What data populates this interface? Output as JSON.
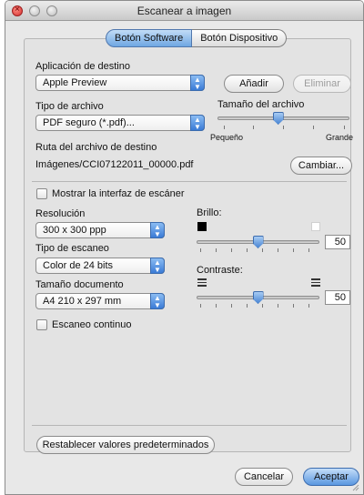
{
  "window": {
    "title": "Escanear a imagen"
  },
  "tabs": [
    {
      "label": "Botón Software",
      "selected": true
    },
    {
      "label": "Botón Dispositivo",
      "selected": false
    }
  ],
  "destination": {
    "label": "Aplicación de destino",
    "app": "Apple Preview",
    "add_button": "Añadir",
    "delete_button": "Eliminar"
  },
  "file_type": {
    "label": "Tipo de archivo",
    "value": "PDF seguro (*.pdf)..."
  },
  "file_size": {
    "label": "Tamaño del archivo",
    "min_label": "Pequeño",
    "max_label": "Grande",
    "level": 0.46
  },
  "path": {
    "label": "Ruta del archivo de destino",
    "value": "Imágenes/CCI07122011_00000.pdf",
    "change_button": "Cambiar..."
  },
  "show_scanner_ui": {
    "label": "Mostrar la interfaz de escáner",
    "checked": false
  },
  "resolution": {
    "label": "Resolución",
    "value": "300 x 300 ppp"
  },
  "scan_type": {
    "label": "Tipo de escaneo",
    "value": "Color de 24 bits"
  },
  "doc_size": {
    "label": "Tamaño documento",
    "value": "A4 210 x 297 mm"
  },
  "continuous_scan": {
    "label": "Escaneo continuo",
    "checked": false
  },
  "brightness": {
    "label": "Brillo:",
    "value": "50",
    "level": 0.5
  },
  "contrast": {
    "label": "Contraste:",
    "value": "50",
    "level": 0.5
  },
  "buttons": {
    "restore": "Restablecer valores predeterminados",
    "cancel": "Cancelar",
    "accept": "Aceptar"
  }
}
